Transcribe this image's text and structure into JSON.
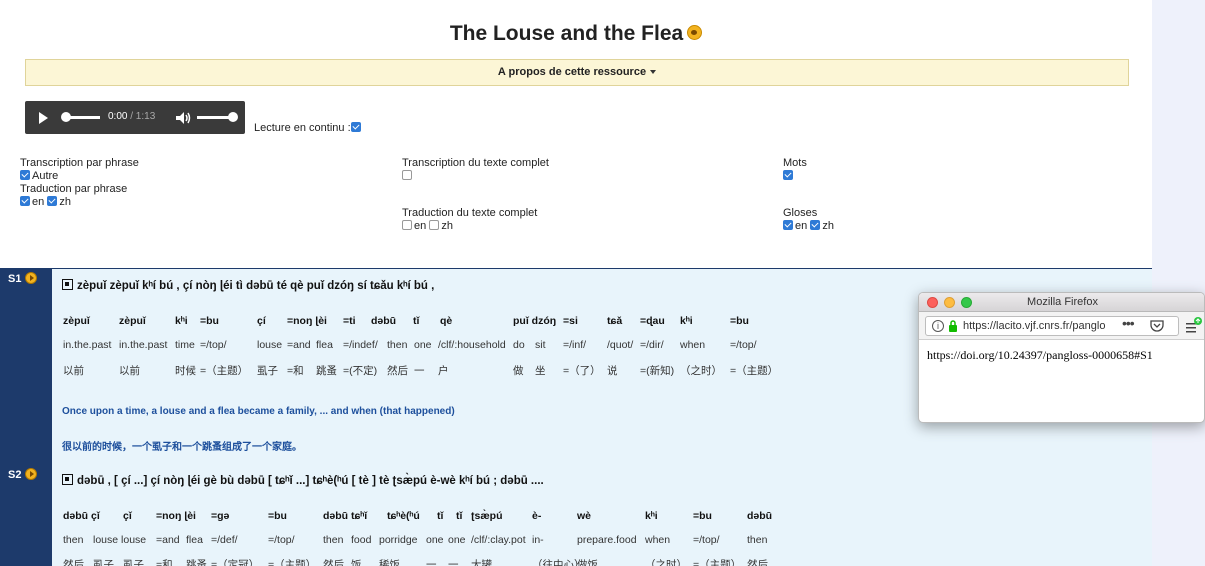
{
  "page": {
    "title": "The Louse and the Flea",
    "about_label": "A propos de cette ressource"
  },
  "player": {
    "current_time": "0:00",
    "duration": "/ 1:13"
  },
  "continuous_label": "Lecture en continu :",
  "options": {
    "trans_phrase": "Transcription par phrase",
    "trans_phrase_other": "Autre",
    "trad_phrase": "Traduction par phrase",
    "trad_phrase_en": "en",
    "trad_phrase_zh": "zh",
    "trans_full": "Transcription du texte complet",
    "trad_full": "Traduction du texte complet",
    "trad_full_en": "en",
    "trad_full_zh": "zh",
    "mots": "Mots",
    "gloses": "Gloses",
    "gloses_en": "en",
    "gloses_zh": "zh"
  },
  "sentences": [
    {
      "label": "S1",
      "text": "zèpuǐ zèpuǐ kʰí bú , çí nòŋ ɭéi tì dəbū té qè puǐ dzóŋ sí tɕǎu kʰí bú ,",
      "ipa": [
        "zèpuǐ",
        "zèpuǐ",
        "kʰi",
        "=bu",
        "çí",
        "=noŋ ɭèi",
        "=ti",
        "dəbū",
        "tǐ",
        "qè",
        "puǐ dzóŋ",
        "=si",
        "tɕǎ",
        "=ɖau",
        "kʰi",
        "=bu"
      ],
      "gloss": [
        "in.the.past",
        "in.the.past",
        "time",
        "=/top/",
        "louse",
        "=and",
        "flea",
        "=/indef/",
        "then",
        "one",
        "/clf/:household",
        "do",
        "sit",
        "=/inf/",
        "/quot/",
        "=/dir/",
        "when",
        "=/top/"
      ],
      "zh": [
        "以前",
        "以前",
        "时候",
        "=（主题）",
        "虱子",
        "=和",
        "跳蚤",
        "=(不定)",
        "然后",
        "一",
        "户",
        "做",
        "坐",
        "=（了）",
        "说",
        "=(新知)",
        "（之时）",
        "=（主题）"
      ],
      "en": "Once upon a time, a louse and a flea became a family, ... and when (that happened)",
      "zh_trans": "很以前的时候，一个虱子和一个跳蚤组成了一个家庭。"
    },
    {
      "label": "S2",
      "text": "dəbū , [ çí ...] çí nòŋ ɭéi gè bù dəbū [ tɕʰǐ ...] tɕʰè(ʰú [ tè ] tè ʈsæ̀pú è-wè kʰí bú ; dəbū ....",
      "ipa": [
        "dəbū çǐ",
        "çǐ",
        "=noŋ ɭèi",
        "=gə",
        "=bu",
        "dəbū tɕʰǐ",
        "tɕʰè(ʰú",
        "tǐ",
        "tǐ",
        "ʈsæ̀pú",
        "è-",
        "wè",
        "kʰi",
        "=bu",
        "dəbū"
      ],
      "gloss": [
        "then",
        "louse louse",
        "=and",
        "flea",
        "=/def/",
        "=/top/",
        "then",
        "food",
        "porridge",
        "one",
        "one",
        "/clf/:clay.pot",
        "in-",
        "prepare.food",
        "when",
        "=/top/",
        "then"
      ],
      "zh": [
        "然后",
        "虱子",
        "虱子",
        "=和",
        "跳蚤",
        "=（定冠）",
        "=（主题）",
        "然后",
        "饭",
        "稀饭",
        "一",
        "一",
        "大罐",
        "（往中心）",
        "做饭",
        "（之时）",
        "=（主题）",
        "然后"
      ]
    }
  ],
  "firefox": {
    "window_title": "Mozilla Firefox",
    "url": "https://lacito.vjf.cnrs.fr/panglo",
    "content": "https://doi.org/10.24397/pangloss-0000658#S1"
  }
}
